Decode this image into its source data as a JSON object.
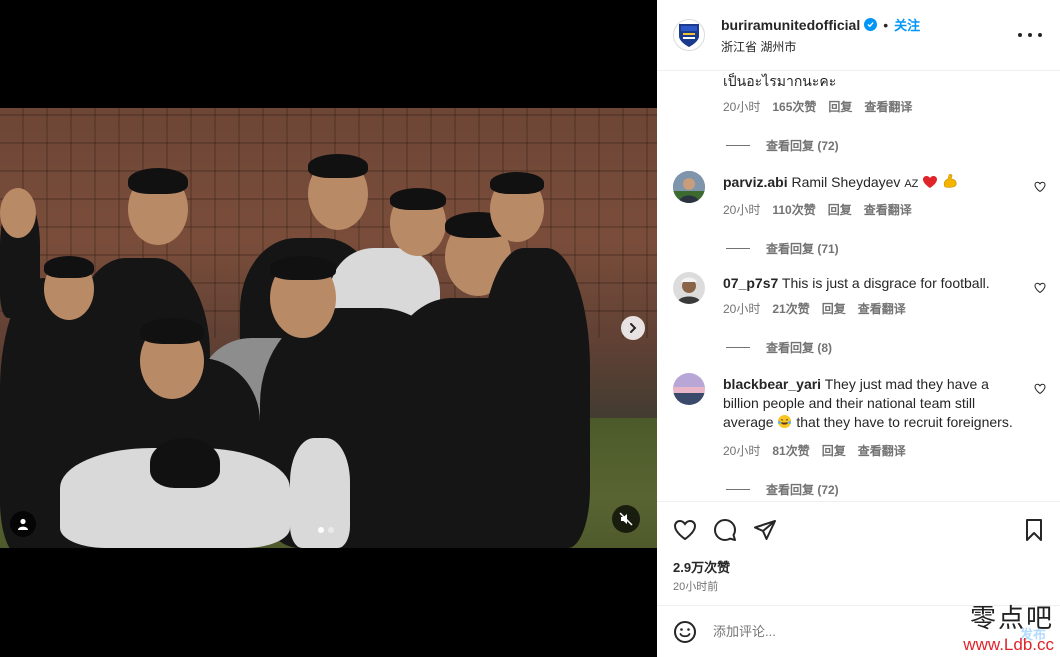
{
  "media": {
    "dots": [
      true,
      false
    ]
  },
  "header": {
    "username": "buriramunitedofficial",
    "separator": "•",
    "follow_label": "关注",
    "location": "浙江省 湖州市"
  },
  "comments": {
    "partial": {
      "text": "เป็นอะไรมากนะคะ",
      "time": "20小时",
      "likes": "165次赞",
      "reply": "回复",
      "translate": "查看翻译",
      "view_replies": "查看回复 (72)"
    },
    "items": [
      {
        "username": "parviz.abi",
        "text": "Ramil Sheydayev",
        "text_suffix": "AZ",
        "emoji": [
          "heart",
          "flexed-biceps"
        ],
        "time": "20小时",
        "likes": "110次赞",
        "reply": "回复",
        "translate": "查看翻译",
        "view_replies": "查看回复 (71)"
      },
      {
        "username": "07_p7s7",
        "text": "This is just a disgrace for football.",
        "time": "20小时",
        "likes": "21次赞",
        "reply": "回复",
        "translate": "查看翻译",
        "view_replies": "查看回复 (8)"
      },
      {
        "username": "blackbear_yari",
        "text_line1": "They just mad they have a",
        "text_line2": "billion people and their national team still",
        "text_line3a": "average",
        "text_line3b": "that they have to recruit foreigners.",
        "emoji": [
          "tears-of-joy"
        ],
        "time": "20小时",
        "likes": "81次赞",
        "reply": "回复",
        "translate": "查看翻译",
        "view_replies": "查看回复 (72)"
      }
    ]
  },
  "actions": {
    "likes": "2.9万次赞",
    "posted": "20小时前"
  },
  "add_comment": {
    "placeholder": "添加评论...",
    "post_label": "发布"
  },
  "watermark": {
    "line1": "零点吧",
    "line2": "www.Ldb.cc"
  },
  "colors": {
    "accent": "#0095f6",
    "text": "#262626",
    "muted": "#737373"
  }
}
